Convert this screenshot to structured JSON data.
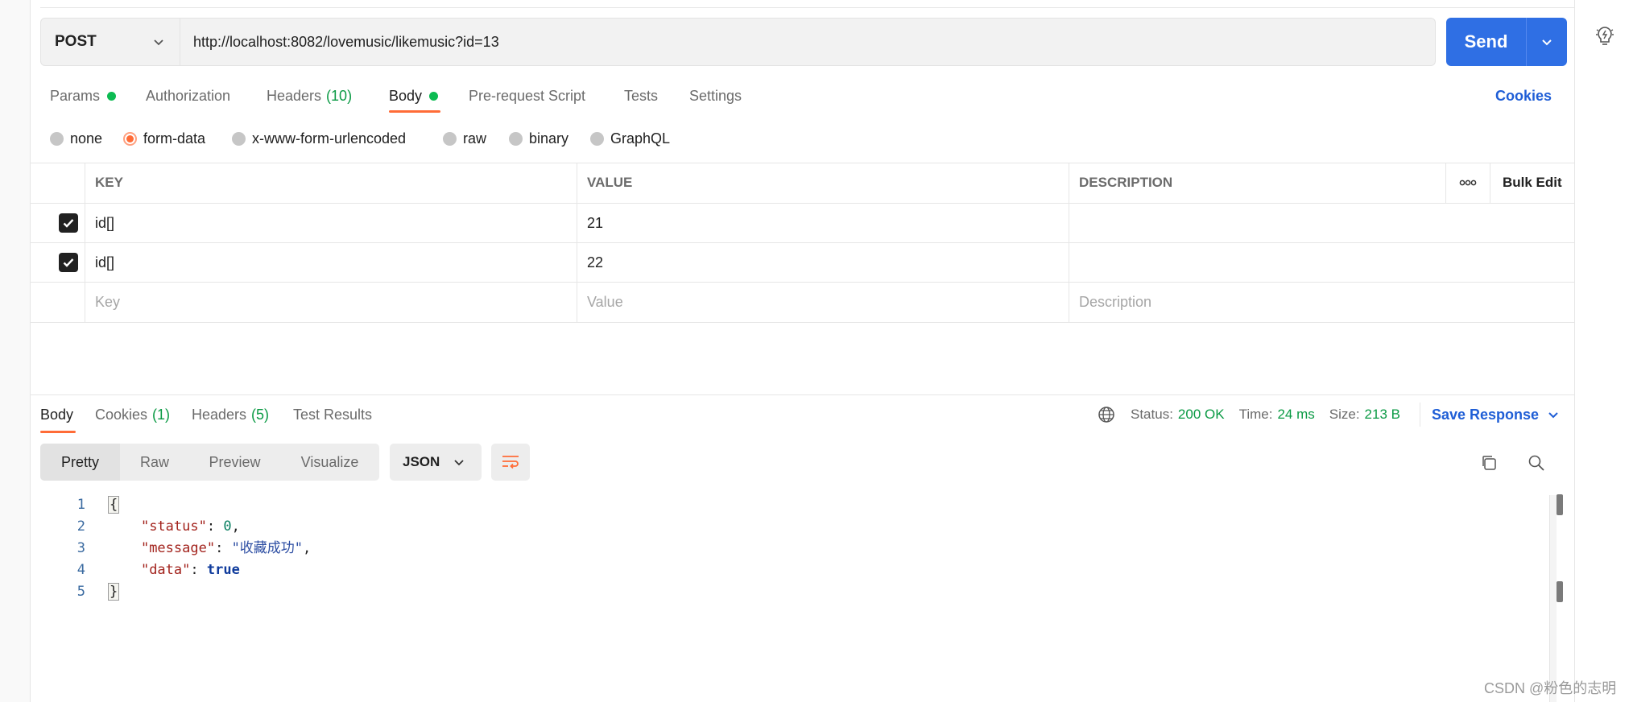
{
  "request": {
    "method": "POST",
    "url": "http://localhost:8082/lovemusic/likemusic?id=13",
    "send_label": "Send"
  },
  "request_tabs": [
    {
      "label": "Params",
      "dot": true
    },
    {
      "label": "Authorization"
    },
    {
      "label": "Headers",
      "count": "(10)"
    },
    {
      "label": "Body",
      "dot": true,
      "active": true
    },
    {
      "label": "Pre-request Script"
    },
    {
      "label": "Tests"
    },
    {
      "label": "Settings"
    }
  ],
  "cookies_link": "Cookies",
  "body_types": [
    "none",
    "form-data",
    "x-www-form-urlencoded",
    "raw",
    "binary",
    "GraphQL"
  ],
  "body_type_selected": "form-data",
  "table": {
    "headers": {
      "key": "KEY",
      "value": "VALUE",
      "description": "DESCRIPTION",
      "bulk_edit": "Bulk Edit"
    },
    "rows": [
      {
        "checked": true,
        "key": "id[]",
        "value": "21",
        "description": ""
      },
      {
        "checked": true,
        "key": "id[]",
        "value": "22",
        "description": ""
      }
    ],
    "placeholders": {
      "key": "Key",
      "value": "Value",
      "description": "Description"
    }
  },
  "response_tabs": [
    {
      "label": "Body",
      "active": true
    },
    {
      "label": "Cookies",
      "count": "(1)"
    },
    {
      "label": "Headers",
      "count": "(5)"
    },
    {
      "label": "Test Results"
    }
  ],
  "response_status": {
    "status_label": "Status:",
    "status_value": "200 OK",
    "time_label": "Time:",
    "time_value": "24 ms",
    "size_label": "Size:",
    "size_value": "213 B",
    "save_response": "Save Response"
  },
  "view_modes": [
    "Pretty",
    "Raw",
    "Preview",
    "Visualize"
  ],
  "view_mode_selected": "Pretty",
  "format_select": "JSON",
  "code": {
    "line_numbers": [
      "1",
      "2",
      "3",
      "4",
      "5"
    ],
    "open_brace": "{",
    "close_brace": "}",
    "entries": [
      {
        "key": "\"status\"",
        "value": "0",
        "type": "number",
        "comma": ","
      },
      {
        "key": "\"message\"",
        "value": "\"收藏成功\"",
        "type": "string",
        "comma": ","
      },
      {
        "key": "\"data\"",
        "value": "true",
        "type": "boolean",
        "comma": ""
      }
    ],
    "colon": ": "
  },
  "watermark": "CSDN @粉色的志明",
  "colors": {
    "accent": "#ff6c37",
    "primary": "#2f6fe4",
    "success": "#0cbb52",
    "link": "#1f5ed6"
  }
}
